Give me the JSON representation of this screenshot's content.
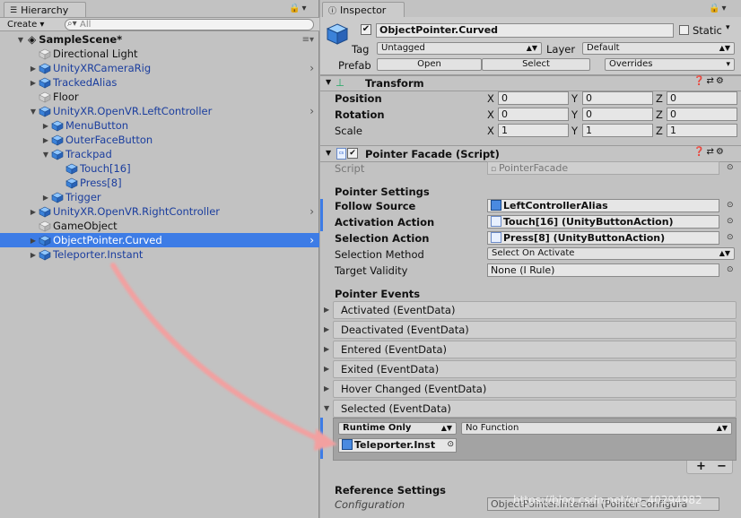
{
  "hierarchy": {
    "tab_label": "Hierarchy",
    "create_label": "Create ▾",
    "search_placeholder": "All",
    "scene_name": "SampleScene*",
    "items": [
      {
        "label": "Directional Light",
        "color": "gray",
        "arrow": ""
      },
      {
        "label": "UnityXRCameraRig",
        "color": "blue",
        "arrow": "▶"
      },
      {
        "label": "TrackedAlias",
        "color": "blue",
        "arrow": "▶"
      },
      {
        "label": "Floor",
        "color": "gray",
        "arrow": ""
      },
      {
        "label": "UnityXR.OpenVR.LeftController",
        "color": "blue",
        "arrow": "▼"
      },
      {
        "label": "MenuButton",
        "color": "blue",
        "arrow": "▶"
      },
      {
        "label": "OuterFaceButton",
        "color": "blue",
        "arrow": "▶"
      },
      {
        "label": "Trackpad",
        "color": "blue",
        "arrow": "▼"
      },
      {
        "label": "Touch[16]",
        "color": "blue",
        "arrow": ""
      },
      {
        "label": "Press[8]",
        "color": "blue",
        "arrow": ""
      },
      {
        "label": "Trigger",
        "color": "blue",
        "arrow": "▶"
      },
      {
        "label": "UnityXR.OpenVR.RightController",
        "color": "blue",
        "arrow": "▶"
      },
      {
        "label": "GameObject",
        "color": "gray",
        "arrow": ""
      },
      {
        "label": "ObjectPointer.Curved",
        "color": "blue",
        "arrow": "▶"
      },
      {
        "label": "Teleporter.Instant",
        "color": "blue",
        "arrow": "▶"
      }
    ]
  },
  "inspector": {
    "tab_label": "Inspector",
    "object_name": "ObjectPointer.Curved",
    "static_label": "Static",
    "tag_label": "Tag",
    "tag_value": "Untagged",
    "layer_label": "Layer",
    "layer_value": "Default",
    "prefab_label": "Prefab",
    "open_label": "Open",
    "select_label": "Select",
    "overrides_label": "Overrides",
    "transform": {
      "title": "Transform",
      "position_label": "Position",
      "rotation_label": "Rotation",
      "scale_label": "Scale",
      "position": [
        "0",
        "0",
        "0"
      ],
      "rotation": [
        "0",
        "0",
        "0"
      ],
      "scale": [
        "1",
        "1",
        "1"
      ]
    },
    "facade": {
      "title": "Pointer Facade (Script)",
      "script_label": "Script",
      "script_value": "PointerFacade",
      "pointer_settings_header": "Pointer Settings",
      "follow_source_label": "Follow Source",
      "follow_source_value": "LeftControllerAlias",
      "activation_label": "Activation Action",
      "activation_value": "Touch[16] (UnityButtonAction)",
      "selection_action_label": "Selection Action",
      "selection_action_value": "Press[8] (UnityButtonAction)",
      "selection_method_label": "Selection Method",
      "selection_method_value": "Select On Activate",
      "target_validity_label": "Target Validity",
      "target_validity_value": "None (I Rule)",
      "pointer_events_header": "Pointer Events",
      "events": [
        "Activated (EventData)",
        "Deactivated (EventData)",
        "Entered (EventData)",
        "Exited (EventData)",
        "Hover Changed (EventData)",
        "Selected (EventData)"
      ],
      "runtime_label": "Runtime Only",
      "function_label": "No Function",
      "listener_object": "Teleporter.Inst",
      "add_label": "+",
      "remove_label": "−",
      "reference_settings_header": "Reference Settings",
      "configuration_label": "Configuration",
      "configuration_value": "ObjectPointer.Internal (PointerConfigura"
    },
    "watermark": "https://blog.csdn.net/qq_40294982"
  },
  "colors": {
    "selection": "#3d7ce6",
    "arrow": "#f2a0a0",
    "blue_text": "#1b3e9e"
  }
}
